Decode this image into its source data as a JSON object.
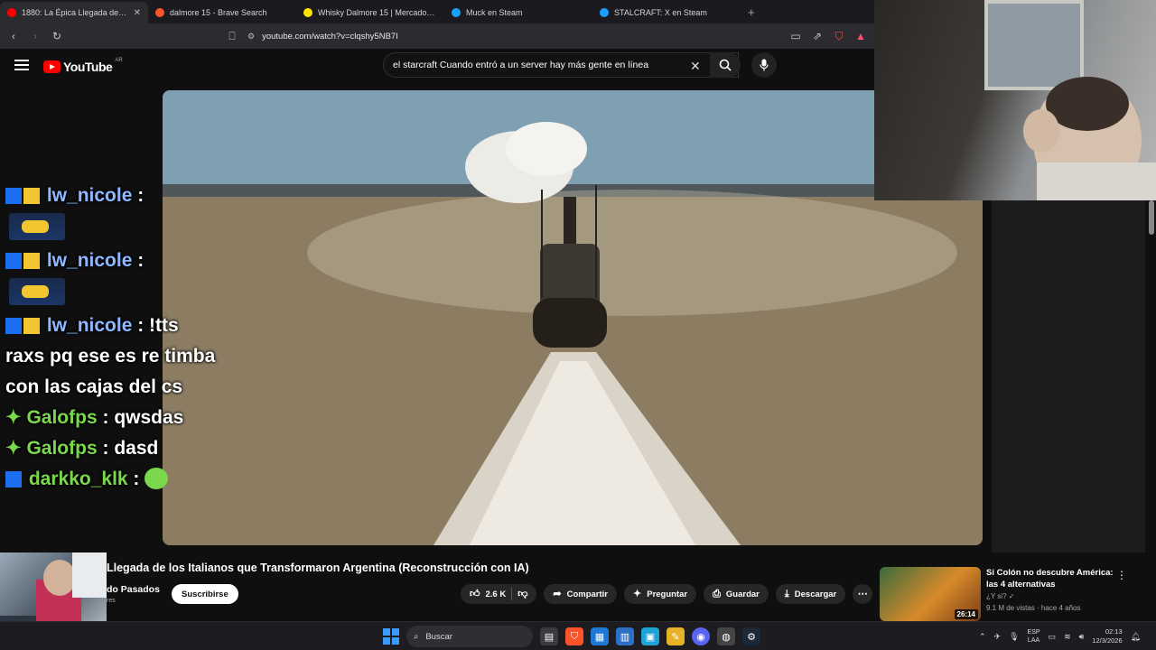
{
  "browser": {
    "tabs": [
      {
        "title": "1880: La Épica Llegada de los",
        "favicon_color": "#ff0000",
        "active": true
      },
      {
        "title": "dalmore 15 - Brave Search",
        "favicon_color": "#fb542b",
        "active": false
      },
      {
        "title": "Whisky Dalmore 15 | MercadoLibre",
        "favicon_color": "#ffe600",
        "active": false
      },
      {
        "title": "Muck en Steam",
        "favicon_color": "#1b9fff",
        "active": false
      },
      {
        "title": "STALCRAFT: X en Steam",
        "favicon_color": "#1b9fff",
        "active": false
      }
    ],
    "new_tab_label": "+",
    "url": "youtube.com/watch?v=clqshy5NB7I"
  },
  "youtube": {
    "logo_text": "YouTube",
    "country": "AR",
    "search_value": "el starcraft Cuando entró a un server hay más gente en línea",
    "video": {
      "title": "Llegada de los Italianos que Transformaron Argentina (Reconstrucción con IA)",
      "channel": "do Pasados",
      "subscribers": "res",
      "subscribe_label": "Suscribirse",
      "likes": "2.6 K",
      "share_label": "Compartir",
      "ask_label": "Preguntar",
      "save_label": "Guardar",
      "download_label": "Descargar"
    },
    "recommendation": {
      "title": "Si Colón no descubre América: las 4 alternativas",
      "channel": "¿Y si?",
      "meta": "9.1 M de vistas · hace 4 años",
      "duration": "26:14"
    }
  },
  "chat": {
    "messages": [
      {
        "user": "lw_nicole",
        "text": "",
        "emote": true
      },
      {
        "user": "lw_nicole",
        "text": "",
        "emote": true
      },
      {
        "user": "lw_nicole",
        "text": "!tts raxs pq ese es re timba con las cajas del cs",
        "emote": false
      },
      {
        "user": "Galofps",
        "text": "qwsdas",
        "emote": false
      },
      {
        "user": "Galofps",
        "text": "dasd",
        "emote": false
      },
      {
        "user": "darkko_klk",
        "text": "",
        "emote": false
      }
    ]
  },
  "taskbar": {
    "search_label": "Buscar",
    "lang_top": "ESP",
    "lang_bottom": "LAA",
    "time": "02:13",
    "date": "12/3/2026"
  }
}
